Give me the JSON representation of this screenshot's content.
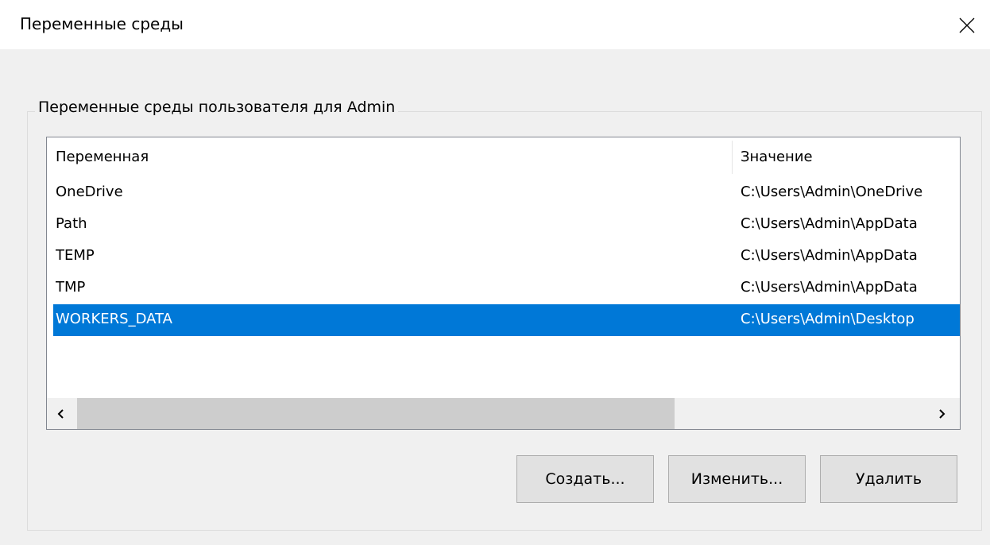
{
  "window": {
    "title": "Переменные среды",
    "close_icon": "close-icon"
  },
  "user_vars": {
    "group_title": "Переменные среды пользователя для Admin",
    "columns": [
      "Переменная",
      "Значение"
    ],
    "rows": [
      {
        "name": "OneDrive",
        "value": "C:\\Users\\Admin\\OneDrive",
        "selected": false
      },
      {
        "name": "Path",
        "value": "C:\\Users\\Admin\\AppData",
        "selected": false
      },
      {
        "name": "TEMP",
        "value": "C:\\Users\\Admin\\AppData",
        "selected": false
      },
      {
        "name": "TMP",
        "value": "C:\\Users\\Admin\\AppData",
        "selected": false
      },
      {
        "name": "WORKERS_DATA",
        "value": "C:\\Users\\Admin\\Desktop",
        "selected": true
      }
    ],
    "scrollbar": {
      "left_icon": "chevron-left-icon",
      "right_icon": "chevron-right-icon"
    },
    "buttons": {
      "create": "Создать...",
      "edit": "Изменить...",
      "delete": "Удалить"
    }
  },
  "colors": {
    "selection": "#0078d7",
    "background": "#f0f0f0"
  }
}
